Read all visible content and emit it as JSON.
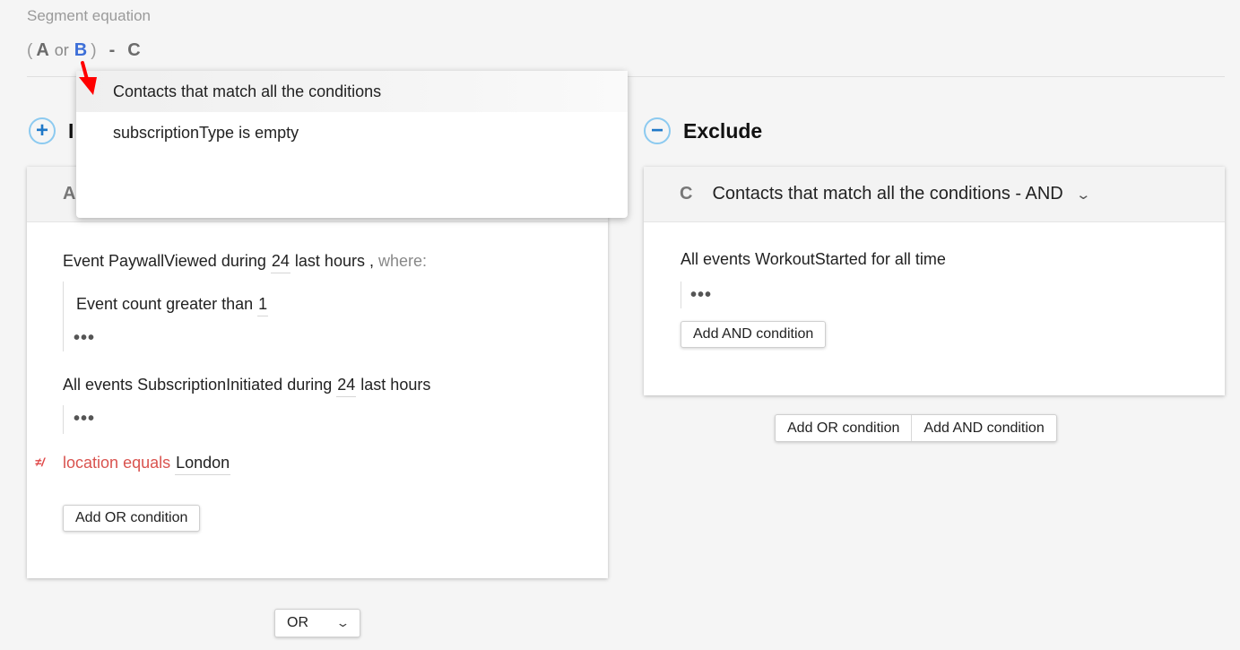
{
  "header": {
    "label": "Segment equation",
    "equation": {
      "open_paren": "(",
      "a": "A",
      "or": "or",
      "b": "B",
      "close_paren": ")",
      "minus": "-",
      "c": "C"
    }
  },
  "include": {
    "title_partial": "I",
    "card_letter": "A",
    "conditions": {
      "c1_prefix": "Event",
      "c1_event": "PaywallViewed",
      "c1_during": "during",
      "c1_value": "24",
      "c1_unit": "last hours",
      "c1_comma": ",",
      "c1_where": "where:",
      "c1_sub_prefix": "Event count",
      "c1_sub_op": "greater than",
      "c1_sub_value": "1",
      "c2_prefix": "All events",
      "c2_event": "SubscriptionInitiated",
      "c2_during": "during",
      "c2_value": "24",
      "c2_unit": "last hours",
      "c3_field": "location",
      "c3_op": "equals",
      "c3_value": "London"
    },
    "more_label": "•••",
    "add_or_label": "Add OR condition"
  },
  "combine": {
    "selected": "OR"
  },
  "exclude": {
    "title": "Exclude",
    "card_letter": "C",
    "card_title": "Contacts that match all the conditions - AND",
    "conditions": {
      "c1_prefix": "All events",
      "c1_event": "WorkoutStarted",
      "c1_range": "for all time"
    },
    "more_label": "•••",
    "add_and_label": "Add AND condition",
    "footer_add_or": "Add OR condition",
    "footer_add_and": "Add AND condition"
  },
  "dropdown": {
    "items": [
      {
        "label": "Contacts that match all the conditions"
      },
      {
        "label": "subscriptionType  is empty"
      }
    ]
  },
  "colors": {
    "accent_blue": "#3d6fd8",
    "circle_border": "#8ccaf0",
    "negation_red": "#d9534f",
    "pointer_red": "#ff0000"
  }
}
